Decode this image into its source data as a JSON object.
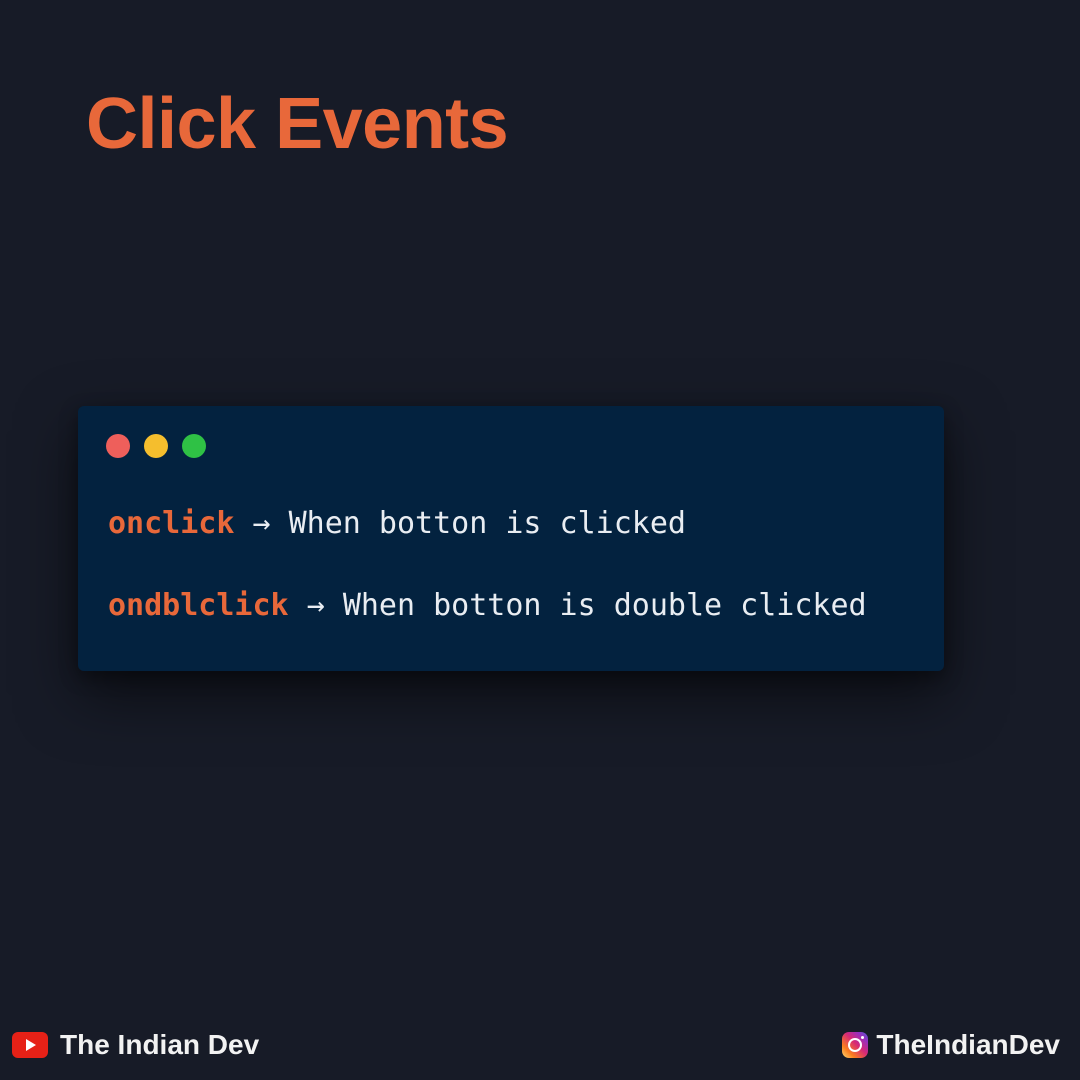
{
  "title": "Click Events",
  "code": {
    "dots": [
      {
        "name": "close-dot",
        "color": "#ee5f5b"
      },
      {
        "name": "minimize-dot",
        "color": "#f5be2d"
      },
      {
        "name": "maximize-dot",
        "color": "#2fc145"
      }
    ],
    "lines": [
      {
        "keyword": "onclick",
        "arrow": "→",
        "description": "When botton is clicked"
      },
      {
        "keyword": "ondblclick",
        "arrow": "→",
        "description": "When botton is double clicked"
      }
    ]
  },
  "footer": {
    "youtube_icon": "youtube-icon",
    "youtube_label": "The Indian Dev",
    "instagram_icon": "instagram-icon",
    "instagram_label": "TheIndianDev"
  },
  "colors": {
    "background": "#171b27",
    "accent": "#e8683a",
    "code_background": "#03223f",
    "youtube_red": "#e62117"
  }
}
